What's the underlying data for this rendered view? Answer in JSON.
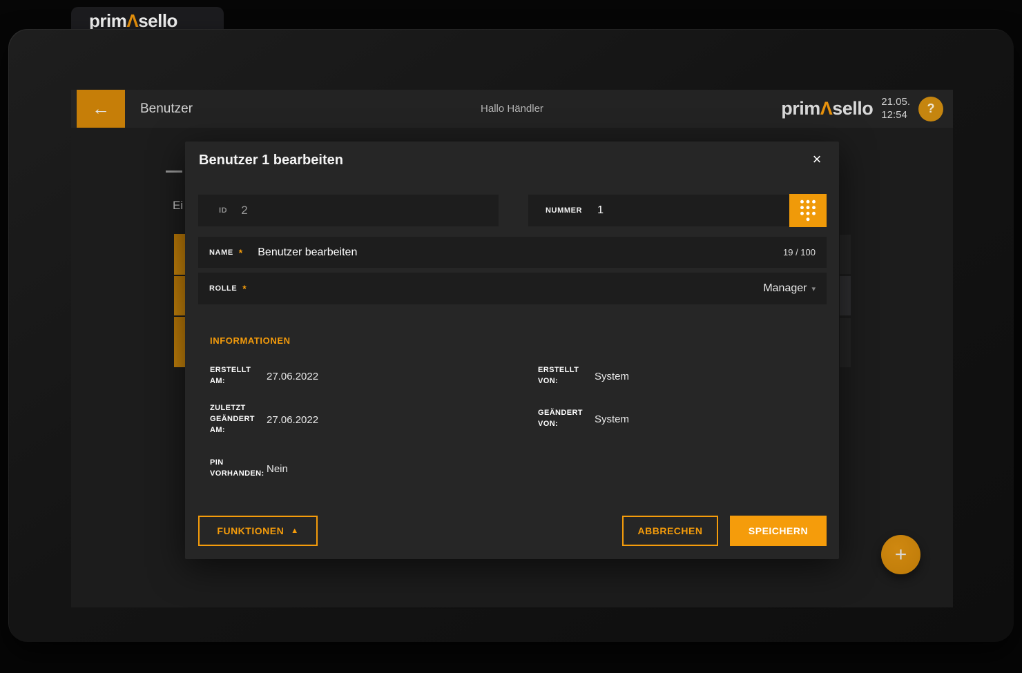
{
  "logo": {
    "part1": "prim",
    "mark": "Λ",
    "part2": "sello"
  },
  "header": {
    "title": "Benutzer",
    "greeting": "Hallo Händler",
    "date": "21.05.",
    "time": "12:54"
  },
  "icons": {
    "back": "←",
    "help": "?",
    "close": "×",
    "caret_down": "▾",
    "triangle_up": "▲",
    "plus": "+",
    "required": "*"
  },
  "background": {
    "fragment": "Ei"
  },
  "modal": {
    "title": "Benutzer 1 bearbeiten",
    "fields": {
      "id": {
        "label": "ID",
        "value": "2"
      },
      "nummer": {
        "label": "NUMMER",
        "value": "1"
      },
      "name": {
        "label": "NAME",
        "value": "Benutzer bearbeiten",
        "counter": "19 / 100"
      },
      "rolle": {
        "label": "ROLLE",
        "value": "Manager"
      }
    },
    "info": {
      "heading": "INFORMATIONEN",
      "rows": [
        {
          "label": "ERSTELLT AM:",
          "value": "27.06.2022"
        },
        {
          "label": "ERSTELLT VON:",
          "value": "System"
        },
        {
          "label": "ZULETZT GEÄNDERT AM:",
          "value": "27.06.2022"
        },
        {
          "label": "GEÄNDERT VON:",
          "value": "System"
        },
        {
          "label": "PIN VORHANDEN:",
          "value": "Nein"
        }
      ]
    },
    "buttons": {
      "funktionen": "FUNKTIONEN",
      "abbrechen": "ABBRECHEN",
      "speichern": "SPEICHERN"
    }
  },
  "colors": {
    "accent": "#f59c0b",
    "accent_dark": "#c67e08"
  }
}
